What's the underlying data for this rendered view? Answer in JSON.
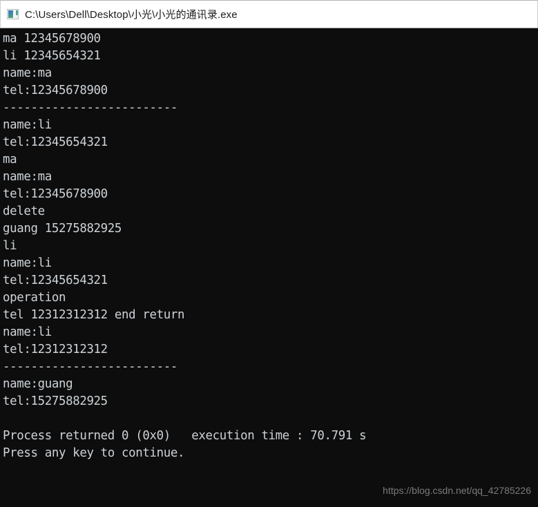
{
  "window": {
    "title": "C:\\Users\\Dell\\Desktop\\小光\\小光的通讯录.exe",
    "icon": "console-app-icon",
    "background_color": "#0d0d0d",
    "titlebar_color": "#ffffff",
    "text_color": "#cdd3d8"
  },
  "console": {
    "lines": [
      "ma 12345678900",
      "li 12345654321",
      "name:ma",
      "tel:12345678900",
      "-------------------------",
      "name:li",
      "tel:12345654321",
      "ma",
      "name:ma",
      "tel:12345678900",
      "delete",
      "guang 15275882925",
      "li",
      "name:li",
      "tel:12345654321",
      "operation",
      "tel 12312312312 end return",
      "name:li",
      "tel:12312312312",
      "-------------------------",
      "name:guang",
      "tel:15275882925",
      "",
      "Process returned 0 (0x0)   execution time : 70.791 s",
      "Press any key to continue."
    ],
    "text": "ma 12345678900\nli 12345654321\nname:ma\ntel:12345678900\n-------------------------\nname:li\ntel:12345654321\nma\nname:ma\ntel:12345678900\ndelete\nguang 15275882925\nli\nname:li\ntel:12345654321\noperation\ntel 12312312312 end return\nname:li\ntel:12312312312\n-------------------------\nname:guang\ntel:15275882925\n\nProcess returned 0 (0x0)   execution time : 70.791 s\nPress any key to continue.",
    "exit_code": "0 (0x0)",
    "execution_time": "70.791 s"
  },
  "watermark": {
    "text": "https://blog.csdn.net/qq_42785226"
  }
}
